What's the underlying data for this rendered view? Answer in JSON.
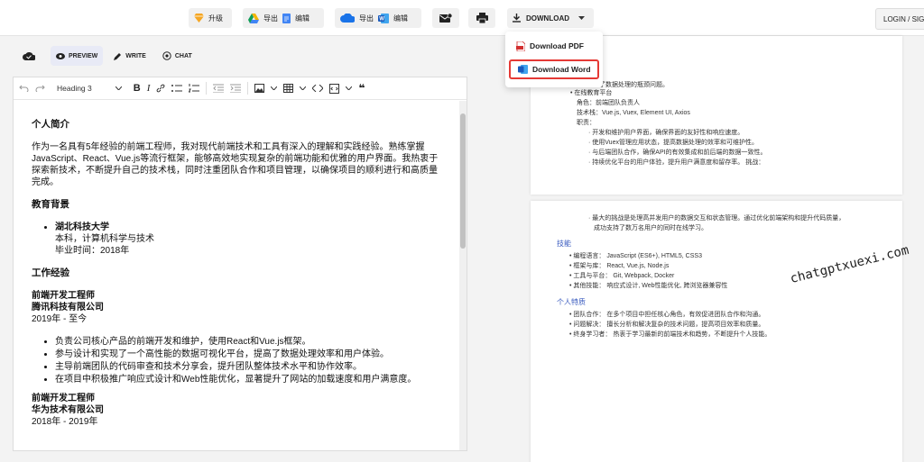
{
  "topbar": {
    "upgrade": "升级",
    "drive_export": "导出",
    "drive_edit": "编辑",
    "onedrive_export": "导出",
    "onedrive_edit": "编辑",
    "download": "DOWNLOAD",
    "login": "LOGIN / SIGN UP"
  },
  "download_menu": {
    "pdf": "Download PDF",
    "word": "Download Word"
  },
  "modes": {
    "preview": "PREVIEW",
    "write": "WRITE",
    "chat": "CHAT"
  },
  "toolbar": {
    "heading": "Heading 3"
  },
  "doc": {
    "intro_title": "个人简介",
    "intro_text": "作为一名具有5年经验的前端工程师，我对现代前端技术和工具有深入的理解和实践经验。熟练掌握JavaScript、React、Vue.js等流行框架，能够高效地实现复杂的前端功能和优雅的用户界面。我热衷于探索新技术，不断提升自己的技术栈，同时注重团队合作和项目管理，以确保项目的顺利进行和高质量完成。",
    "edu_title": "教育背景",
    "school": "湖北科技大学",
    "degree": "本科，计算机科学与技术",
    "graduation": "毕业时间：2018年",
    "work_title": "工作经验",
    "job1_title": "前端开发工程师",
    "job1_company": "腾讯科技有限公司",
    "job1_period": "2019年 - 至今",
    "job1_items": [
      "负责公司核心产品的前端开发和维护，使用React和Vue.js框架。",
      "参与设计和实现了一个高性能的数据可视化平台，提高了数据处理效率和用户体验。",
      "主导前端团队的代码审查和技术分享会，提升团队整体技术水平和协作效率。",
      "在项目中积极推广响应式设计和Web性能优化，显著提升了网站的加载速度和用户满意度。"
    ],
    "job2_title": "前端开发工程师",
    "job2_company": "华为技术有限公司",
    "job2_period": "2018年 - 2019年"
  },
  "preview": {
    "p1_lines": [
      "题，成功解决了数据处理的瓶颈问题。",
      "• 在线教育平台",
      "角色：前端团队负责人",
      "技术栈：Vue.js, Vuex, Element UI, Axios",
      "职责：",
      "· 开发和维护用户界面，确保界面的友好性和响应速度。",
      "· 使用Vuex管理应用状态，提高数据处理的效率和可维护性。",
      "· 与后端团队合作，确保API的有效集成和前后端的数据一致性。",
      "· 持续优化平台的用户体验，提升用户满意度和留存率。  挑战："
    ],
    "p2_challenge_1": "· 最大的挑战是处理高并发用户的数据交互和状态管理。通过优化前端架构和提升代码质量，",
    "p2_challenge_2": "成功支持了数万名用户的同时在线学习。",
    "skills_title": "技能",
    "skills": [
      "• 编程语言： JavaScript (ES6+), HTML5, CSS3",
      "• 框架与库： React, Vue.js, Node.js",
      "• 工具与平台： Git, Webpack, Docker",
      "• 其他技能： 响应式设计, Web性能优化, 跨浏览器兼容性"
    ],
    "traits_title": "个人特质",
    "traits": [
      "• 团队合作： 在多个项目中担任核心角色，有效促进团队合作和沟通。",
      "• 问题解决： 擅长分析和解决复杂的技术问题，提高项目效率和质量。",
      "• 终身学习者： 热衷于学习最新的前端技术和趋势，不断提升个人技能。"
    ]
  },
  "watermark": "chatgptxuexi.com",
  "colors": {
    "accent_red": "#e53935",
    "preview_heading_blue": "#3a5bbf"
  }
}
